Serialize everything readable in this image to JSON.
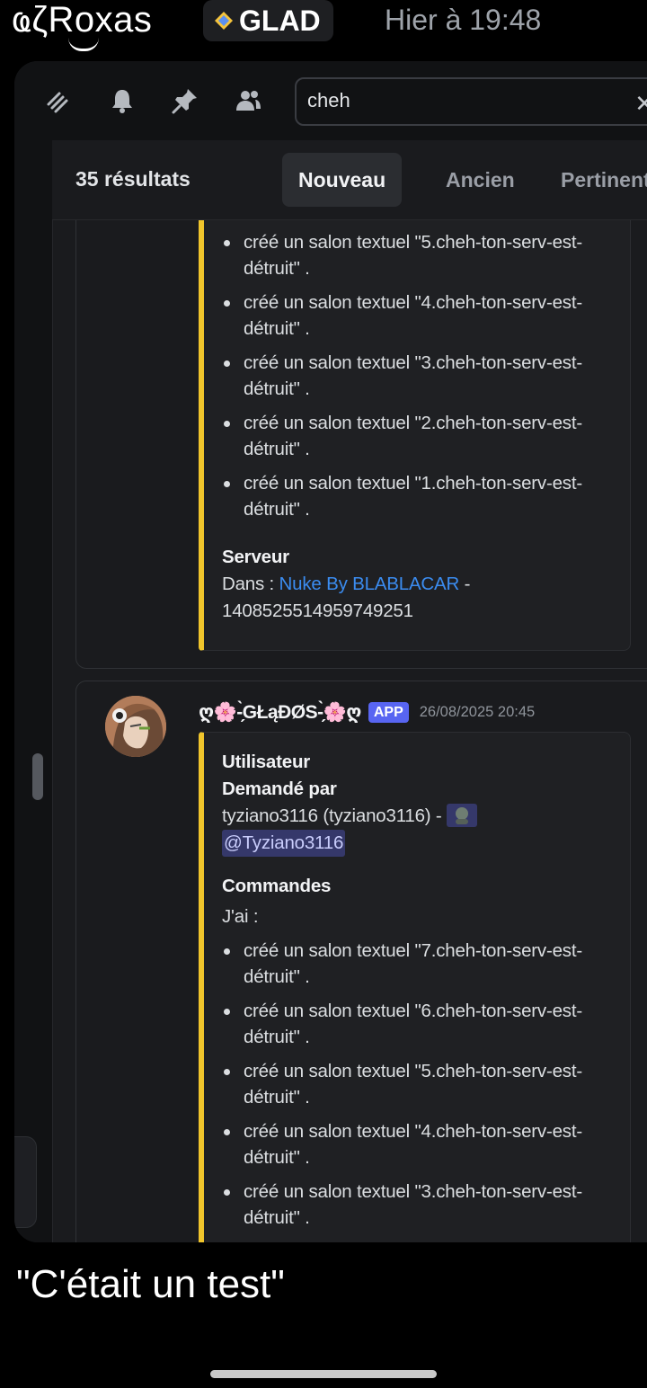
{
  "caption_bar": {
    "author_name": "ҩζRoxas",
    "server_tag": "GLAD",
    "timestamp": "Hier à 19:48"
  },
  "toolbar": {
    "icons": [
      "threads-icon",
      "bell-icon",
      "pin-icon",
      "members-icon"
    ],
    "search_value": "cheh",
    "clear_symbol": "✕"
  },
  "results": {
    "count_label": "35 résultats",
    "sort_tabs": [
      {
        "label": "Nouveau",
        "active": true
      },
      {
        "label": "Ancien",
        "active": false
      },
      {
        "label": "Pertinent",
        "active": false
      }
    ]
  },
  "result1": {
    "items": [
      "créé un salon textuel \"5.cheh-ton-serv-est-détruit\" .",
      "créé un salon textuel \"4.cheh-ton-serv-est-détruit\" .",
      "créé un salon textuel \"3.cheh-ton-serv-est-détruit\" .",
      "créé un salon textuel \"2.cheh-ton-serv-est-détruit\" .",
      "créé un salon textuel \"1.cheh-ton-serv-est-détruit\" ."
    ],
    "server_title": "Serveur",
    "server_prefix": "Dans : ",
    "server_link": "Nuke By BLABLACAR",
    "server_suffix": " -",
    "server_id": "1408525514959749251"
  },
  "result2": {
    "bot_name": "ღ🌸-̗̀GŁąĐØS-̗̀🌸ღ",
    "app_badge": "APP",
    "time": "26/08/2025 20:45",
    "field_user": "Utilisateur",
    "requested_by": "Demandé par",
    "requester": "tyziano3116 (tyziano3116) -",
    "mention": "@Tyziano3116",
    "field_commands": "Commandes",
    "jai": "J'ai :",
    "items": [
      "créé un salon textuel \"7.cheh-ton-serv-est-détruit\" .",
      "créé un salon textuel \"6.cheh-ton-serv-est-détruit\" .",
      "créé un salon textuel \"5.cheh-ton-serv-est-détruit\" .",
      "créé un salon textuel \"4.cheh-ton-serv-est-détruit\" .",
      "créé un salon textuel \"3.cheh-ton-serv-est-détruit\" ."
    ]
  },
  "caption": "\"C'était un test\"",
  "colors": {
    "embed_border": "#f0c52c",
    "link": "#3b8cf0",
    "app_badge": "#5865f2",
    "mention_bg": "#35386a"
  }
}
